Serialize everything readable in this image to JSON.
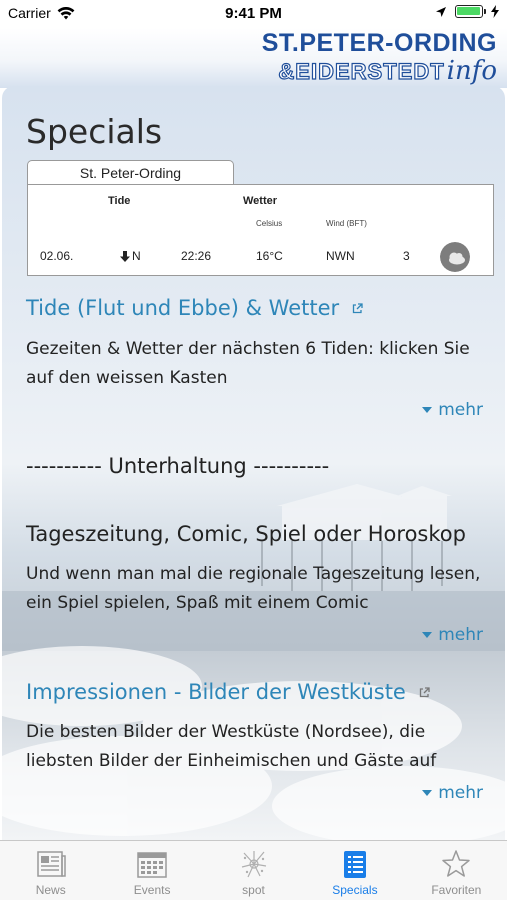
{
  "status_bar": {
    "carrier": "Carrier",
    "time": "9:41 PM",
    "battery_level": 1.0
  },
  "header": {
    "logo_line1": "ST.PETER-ORDING",
    "logo_line2": "&EIDERSTEDT",
    "logo_info": "info"
  },
  "page": {
    "title": "Specials"
  },
  "tide_widget": {
    "tab_label": "St. Peter-Ording",
    "tide_heading": "Tide",
    "weather_heading": "Wetter",
    "celsius_label": "Celsius",
    "wind_label": "Wind (BFT)",
    "date": "02.06.",
    "tide_direction": "N",
    "tide_time": "22:26",
    "temperature": "16°C",
    "wind_direction": "NWN",
    "wind_strength": "3",
    "weather_icon": "cloud-night-icon"
  },
  "sections": {
    "tide_link": "Tide (Flut und Ebbe) & Wetter",
    "tide_desc": "Gezeiten & Wetter der nächsten 6 Tiden: klicken Sie auf den weissen Kasten",
    "tide_more": "mehr",
    "entertainment_heading": "---------- Unterhaltung ----------",
    "newspaper_title": "Tageszeitung, Comic, Spiel oder Horoskop",
    "newspaper_desc": "Und wenn man mal die regionale Tageszeitung lesen, ein Spiel spielen, Spaß mit einem Comic",
    "newspaper_more": "mehr",
    "impressions_link": "Impressionen - Bilder der Westküste",
    "impressions_desc": "Die besten Bilder der Westküste (Nordsee), die liebsten Bilder der Einheimischen und Gäste auf",
    "impressions_more": "mehr"
  },
  "tab_bar": {
    "items": [
      {
        "label": "News",
        "icon": "newspaper-icon"
      },
      {
        "label": "Events",
        "icon": "calendar-icon"
      },
      {
        "label": "spot",
        "icon": "splash-icon"
      },
      {
        "label": "Specials",
        "icon": "list-icon"
      },
      {
        "label": "Favoriten",
        "icon": "star-icon"
      }
    ],
    "active": "Specials"
  },
  "colors": {
    "link": "#2e86b8",
    "tab_active": "#1a7ee8",
    "logo_blue": "#1f4e9a"
  }
}
